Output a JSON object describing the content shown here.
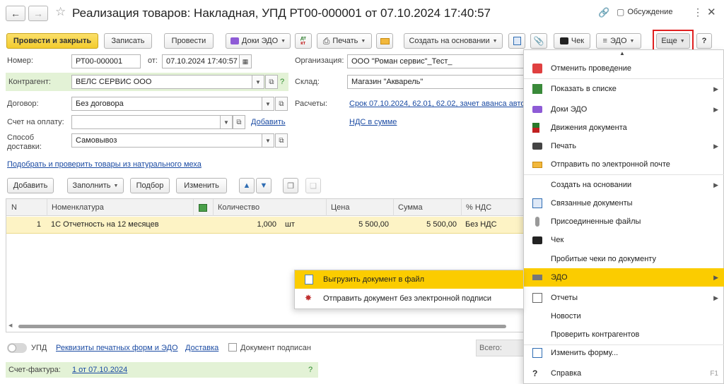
{
  "window": {
    "title": "Реализация товаров: Накладная, УПД РТ00-000001 от 07.10.2024 17:40:57",
    "discussion_label": "Обсуждение"
  },
  "toolbar": {
    "post_close": "Провести и закрыть",
    "save": "Записать",
    "post": "Провести",
    "docs_edo": "Доки ЭДО",
    "print": "Печать",
    "create_based": "Создать на основании",
    "check": "Чек",
    "edo": "ЭДО",
    "more": "Еще",
    "help": "?"
  },
  "form": {
    "number_label": "Номер:",
    "number_value": "РТ00-000001",
    "date_label": "от:",
    "date_value": "07.10.2024 17:40:57",
    "org_label": "Организация:",
    "org_value": "ООО \"Роман сервис\"_Тест_",
    "counterparty_label": "Контрагент:",
    "counterparty_value": "ВЕЛС СЕРВИС ООО",
    "warehouse_label": "Склад:",
    "warehouse_value": "Магазин \"Акварель\"",
    "contract_label": "Договор:",
    "contract_value": "Без договора",
    "settlements_label": "Расчеты:",
    "settlements_link": "Срок 07.10.2024, 62.01, 62.02, зачет аванса авто",
    "invoice_label": "Счет на оплату:",
    "invoice_value": "",
    "invoice_add": "Добавить",
    "vat_link": "НДС в сумме",
    "delivery_label_1": "Способ",
    "delivery_label_2": "доставки:",
    "delivery_value": "Самовывоз",
    "fur_link": "Подобрать и проверить товары из натурального меха",
    "help_q": "?"
  },
  "table_toolbar": {
    "add": "Добавить",
    "fill": "Заполнить",
    "pick": "Подбор",
    "change": "Изменить"
  },
  "table": {
    "headers": [
      "N",
      "Номенклатура",
      "Количество",
      "Цена",
      "Сумма",
      "% НДС"
    ],
    "rows": [
      {
        "n": "1",
        "item": "1С Отчетность на 12 месяцев",
        "qty": "1,000",
        "unit": "шт",
        "price": "5 500,00",
        "sum": "5 500,00",
        "vat": "Без НДС"
      }
    ]
  },
  "footer": {
    "upd_label": "УПД",
    "print_forms_link": "Реквизиты печатных форм и ЭДО",
    "delivery_link": "Доставка",
    "signed_label": "Документ подписан",
    "total_label": "Всего:",
    "invoice_label": "Счет-фактура:",
    "invoice_link": "1 от 07.10.2024",
    "help_q": "?"
  },
  "more_menu": {
    "items": [
      {
        "label": "Отменить проведение",
        "icon": "unpost-icon",
        "arrow": false
      },
      {
        "label": "Показать в списке",
        "icon": "list-icon",
        "arrow": true
      },
      {
        "label": "Доки ЭДО",
        "icon": "folder-icon",
        "arrow": true
      },
      {
        "label": "Движения документа",
        "icon": "dt-kt-icon",
        "arrow": false
      },
      {
        "label": "Печать",
        "icon": "printer-icon",
        "arrow": true
      },
      {
        "label": "Отправить по электронной почте",
        "icon": "envelope-icon",
        "arrow": false
      },
      {
        "label": "Создать на основании",
        "icon": "",
        "arrow": true
      },
      {
        "label": "Связанные документы",
        "icon": "linked-docs-icon",
        "arrow": false
      },
      {
        "label": "Присоединенные файлы",
        "icon": "paperclip-icon",
        "arrow": false
      },
      {
        "label": "Чек",
        "icon": "cash-register-icon",
        "arrow": false
      },
      {
        "label": "Пробитые чеки по документу",
        "icon": "",
        "arrow": false
      },
      {
        "label": "ЭДО",
        "icon": "edo-icon",
        "arrow": true
      },
      {
        "label": "Отчеты",
        "icon": "report-icon",
        "arrow": true
      },
      {
        "label": "Новости",
        "icon": "",
        "arrow": false
      },
      {
        "label": "Проверить контрагентов",
        "icon": "",
        "arrow": false
      },
      {
        "label": "Изменить форму...",
        "icon": "form-settings-icon",
        "arrow": false
      },
      {
        "label": "Справка",
        "icon": "help-icon",
        "arrow": false,
        "shortcut": "F1"
      }
    ]
  },
  "edo_submenu": {
    "items": [
      {
        "label": "Выгрузить документ в файл",
        "icon": "export-file-icon"
      },
      {
        "label": "Отправить документ без электронной подписи",
        "icon": "send-unsigned-icon"
      }
    ]
  },
  "colors": {
    "primary_button": "#f7d43a",
    "highlight": "#fbcc00",
    "selected_row": "#fdf3c5",
    "green_field": "#e3f2d6",
    "link": "#1b4ba3",
    "red_outline": "#e02020"
  }
}
